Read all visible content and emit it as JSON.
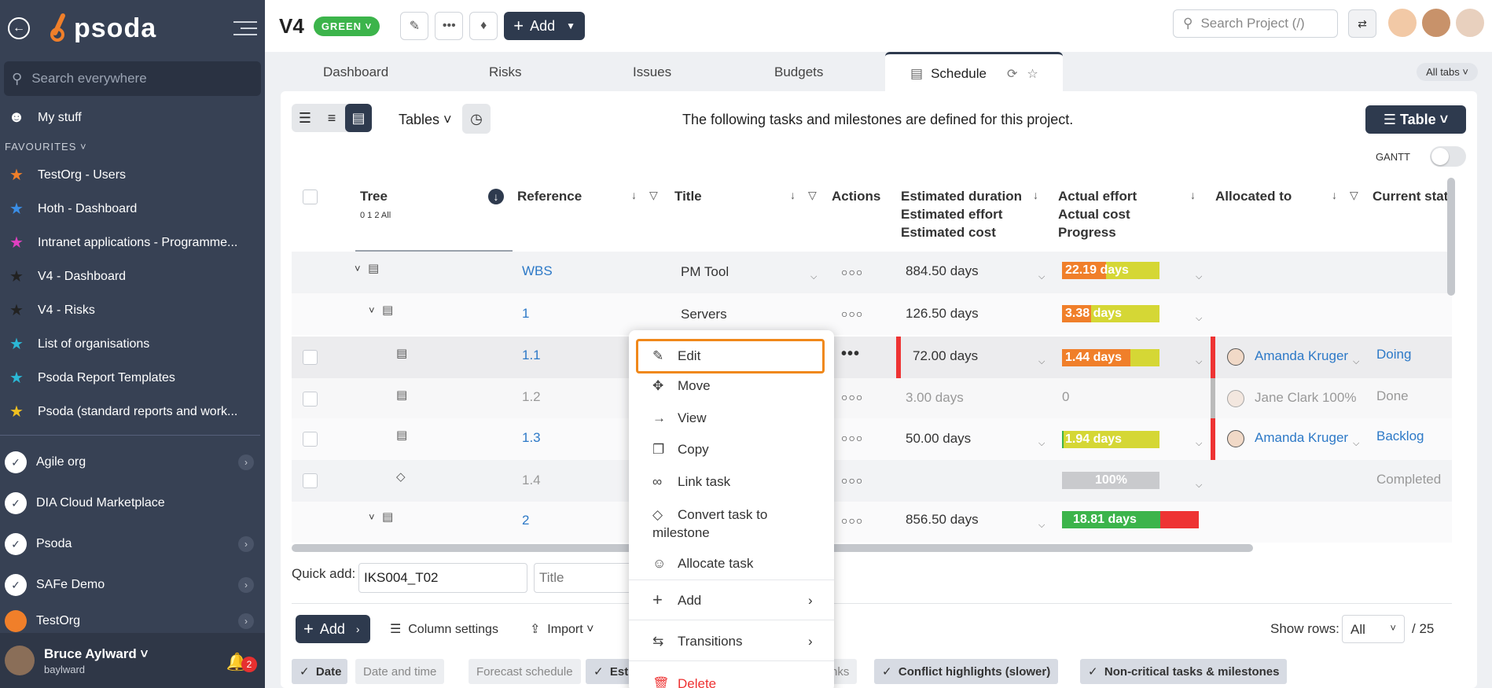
{
  "sidebar": {
    "logo": "psoda",
    "search_placeholder": "Search everywhere",
    "my_stuff": "My stuff",
    "favourites_label": "FAVOURITES",
    "favourites": [
      {
        "label": "TestOrg - Users",
        "color": "#f07f2a"
      },
      {
        "label": "Hoth - Dashboard",
        "color": "#3a8ee6"
      },
      {
        "label": "Intranet applications - Programme...",
        "color": "#e040c0"
      },
      {
        "label": "V4 - Dashboard",
        "color": "#222222"
      },
      {
        "label": "V4 - Risks",
        "color": "#222222"
      },
      {
        "label": "List of organisations",
        "color": "#2bb8d6"
      },
      {
        "label": "Psoda Report Templates",
        "color": "#2bb8d6"
      },
      {
        "label": "Psoda (standard reports and work...",
        "color": "#f0c020"
      }
    ],
    "orgs": [
      "Agile org",
      "DIA Cloud Marketplace",
      "Psoda",
      "SAFe Demo",
      "TestOrg"
    ],
    "user": {
      "name": "Bruce Aylward",
      "login": "baylward",
      "notifications": "2"
    }
  },
  "header": {
    "project": "V4",
    "status": "GREEN",
    "add_label": "Add",
    "search_placeholder": "Search Project (/)"
  },
  "tabs": {
    "items": [
      "Dashboard",
      "Risks",
      "Issues",
      "Budgets"
    ],
    "active": "Schedule",
    "all_tabs": "All tabs"
  },
  "panel": {
    "tables_label": "Tables",
    "description": "The following tasks and milestones are defined for this project.",
    "table_btn": "Table",
    "gantt": "GANTT"
  },
  "columns": {
    "tree": "Tree",
    "tree_levels": "0 1 2 All",
    "reference": "Reference",
    "title": "Title",
    "actions": "Actions",
    "est_1": "Estimated duration",
    "est_2": "Estimated effort",
    "est_3": "Estimated cost",
    "act_1": "Actual effort",
    "act_2": "Actual cost",
    "act_3": "Progress",
    "allocated": "Allocated to",
    "status": "Current stat"
  },
  "rows": [
    {
      "ref": "WBS",
      "title": "PM Tool",
      "duration": "884.50 days",
      "actual": "22.19 days",
      "progress": 0.45,
      "fill": "#f07f2a"
    },
    {
      "ref": "1",
      "title": "Servers",
      "duration": "126.50 days",
      "actual": "3.38 days",
      "progress": 0.3,
      "fill": "#f07f2a"
    },
    {
      "ref": "1.1",
      "title": "",
      "duration": "72.00 days",
      "actual": "1.44 days",
      "progress": 0.7,
      "fill": "#f07f2a",
      "allocated": "Amanda Kruger",
      "status": "Doing"
    },
    {
      "ref": "1.2",
      "title": "",
      "duration": "3.00 days",
      "actual": "0",
      "allocated": "Jane Clark 100%",
      "status": "Done"
    },
    {
      "ref": "1.3",
      "title": "",
      "duration": "50.00 days",
      "actual": "1.94 days",
      "progress": 0.02,
      "fill": "#3cb44b",
      "allocated": "Amanda Kruger",
      "status": "Backlog"
    },
    {
      "ref": "1.4",
      "title": "",
      "duration": "",
      "actual": "100%",
      "status": "Completed"
    },
    {
      "ref": "2",
      "title": "",
      "duration": "856.50 days",
      "actual": "18.81 days",
      "progress": 0.72,
      "fill": "#3cb44b"
    }
  ],
  "quick_add": {
    "label": "Quick add:",
    "ref_value": "IKS004_T02",
    "title_placeholder": "Title"
  },
  "footer": {
    "add": "Add",
    "column_settings": "Column settings",
    "import": "Import",
    "show_rows": "Show rows:",
    "rows_value": "All",
    "total": "/ 25"
  },
  "chips": {
    "date": "Date",
    "date_time": "Date and time",
    "forecast": "Forecast schedule",
    "est": "Est",
    "nks": "nks",
    "conflict": "Conflict highlights (slower)",
    "noncritical": "Non-critical tasks & milestones"
  },
  "menu": {
    "edit": "Edit",
    "move": "Move",
    "view": "View",
    "copy": "Copy",
    "link": "Link task",
    "convert": "Convert task to milestone",
    "allocate": "Allocate task",
    "add": "Add",
    "transitions": "Transitions",
    "delete": "Delete"
  }
}
